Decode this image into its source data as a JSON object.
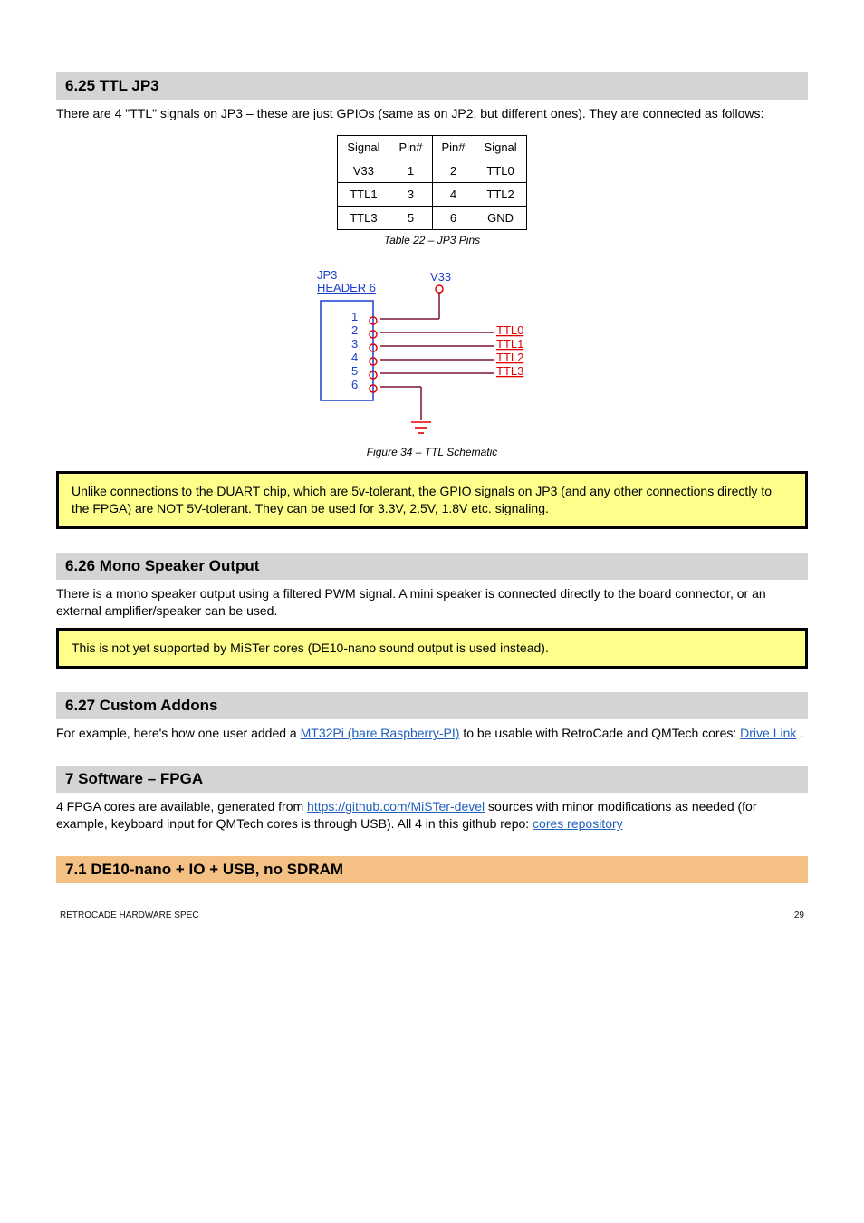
{
  "sec1": {
    "title": "6.25 TTL JP3",
    "body": "There are 4 \"TTL\" signals on JP3 – these are just GPIOs (same as on JP2, but different ones). They are connected as follows:",
    "table": {
      "head": [
        "Signal",
        "Pin#",
        "Pin#",
        "Signal"
      ],
      "rows": [
        [
          "V33",
          "1",
          "2",
          "TTL0"
        ],
        [
          "TTL1",
          "3",
          "4",
          "TTL2"
        ],
        [
          "TTL3",
          "5",
          "6",
          "GND"
        ]
      ],
      "caption": "Table 22 – JP3 Pins"
    },
    "figure_caption": "Figure 34 – TTL Schematic",
    "schem": {
      "header_label": "JP3",
      "header_sub": "HEADER 6",
      "v33_label": "V33",
      "pins": [
        "1",
        "2",
        "3",
        "4",
        "5",
        "6"
      ],
      "nets": [
        "TTL0",
        "TTL1",
        "TTL2",
        "TTL3"
      ]
    },
    "warn": "Unlike connections to the DUART chip, which are 5v-tolerant, the GPIO signals on JP3 (and any other connections directly to the FPGA) are NOT 5V-tolerant. They can be used for 3.3V, 2.5V, 1.8V etc. signaling."
  },
  "sec2": {
    "title": "6.26 Mono Speaker Output",
    "body": "There is a mono speaker output using a filtered PWM signal. A mini speaker is connected directly to the board connector, or an external amplifier/speaker can be used.",
    "warn": "This is not yet supported by MiSTer cores (DE10-nano sound output is used instead)."
  },
  "sec3": {
    "title": "6.27 Custom Addons",
    "body_parts": [
      "For example, here's how one user added a ",
      " to be usable with RetroCade and QMTech cores: ",
      "."
    ],
    "link1_text": "MT32Pi (bare Raspberry-PI)",
    "link2_text": "Drive Link"
  },
  "sec4": {
    "title": "7 Software – FPGA",
    "body_parts": [
      "4 FPGA cores are available, generated from ",
      " sources with minor modifications as needed (for example, keyboard input for QMTech cores is through USB). All 4 in this github repo: ",
      ""
    ],
    "link1_text": "https://github.com/MiSTer-devel",
    "link2_text": "cores repository"
  },
  "sec5": {
    "title": "7.1 DE10-nano + IO + USB, no SDRAM"
  },
  "footer": {
    "left": "RETROCADE HARDWARE SPEC",
    "right": "29"
  }
}
